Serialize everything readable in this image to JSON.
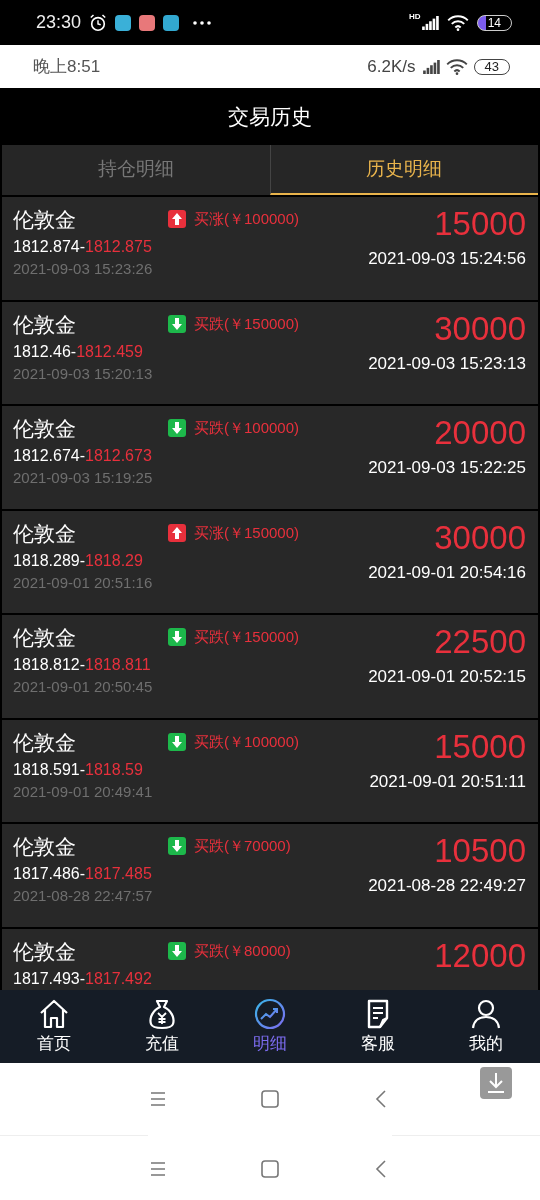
{
  "status_bar": {
    "time": "23:30",
    "hd": "HD",
    "battery": "14"
  },
  "inner_status_bar": {
    "time": "晚上8:51",
    "speed": "6.2K/s",
    "battery": "43"
  },
  "header": {
    "title": "交易历史"
  },
  "tabs": [
    {
      "label": "持仓明细",
      "selected": false
    },
    {
      "label": "历史明细",
      "selected": true
    }
  ],
  "trades": [
    {
      "name": "伦敦金",
      "kind": "up",
      "order": "买涨(￥100000)",
      "price_open": "1812.874-",
      "price_close": "1812.875",
      "open_time": "2021-09-03 15:23:26",
      "amount": "15000",
      "close_time": "2021-09-03 15:24:56"
    },
    {
      "name": "伦敦金",
      "kind": "down",
      "order": "买跌(￥150000)",
      "price_open": "1812.46-",
      "price_close": "1812.459",
      "open_time": "2021-09-03 15:20:13",
      "amount": "30000",
      "close_time": "2021-09-03 15:23:13"
    },
    {
      "name": "伦敦金",
      "kind": "down",
      "order": "买跌(￥100000)",
      "price_open": "1812.674-",
      "price_close": "1812.673",
      "open_time": "2021-09-03 15:19:25",
      "amount": "20000",
      "close_time": "2021-09-03 15:22:25"
    },
    {
      "name": "伦敦金",
      "kind": "up",
      "order": "买涨(￥150000)",
      "price_open": "1818.289-",
      "price_close": "1818.29",
      "open_time": "2021-09-01 20:51:16",
      "amount": "30000",
      "close_time": "2021-09-01 20:54:16"
    },
    {
      "name": "伦敦金",
      "kind": "down",
      "order": "买跌(￥150000)",
      "price_open": "1818.812-",
      "price_close": "1818.811",
      "open_time": "2021-09-01 20:50:45",
      "amount": "22500",
      "close_time": "2021-09-01 20:52:15"
    },
    {
      "name": "伦敦金",
      "kind": "down",
      "order": "买跌(￥100000)",
      "price_open": "1818.591-",
      "price_close": "1818.59",
      "open_time": "2021-09-01 20:49:41",
      "amount": "15000",
      "close_time": "2021-09-01 20:51:11"
    },
    {
      "name": "伦敦金",
      "kind": "down",
      "order": "买跌(￥70000)",
      "price_open": "1817.486-",
      "price_close": "1817.485",
      "open_time": "2021-08-28 22:47:57",
      "amount": "10500",
      "close_time": "2021-08-28 22:49:27"
    },
    {
      "name": "伦敦金",
      "kind": "down",
      "order": "买跌(￥80000)",
      "price_open": "1817.493-",
      "price_close": "1817.492",
      "amount": "12000"
    }
  ],
  "bottom_nav": [
    {
      "kind": "home",
      "label": "首页",
      "selected": false
    },
    {
      "kind": "money",
      "label": "充值",
      "selected": false
    },
    {
      "kind": "chart",
      "label": "明细",
      "selected": true
    },
    {
      "kind": "document",
      "label": "客服",
      "selected": false
    },
    {
      "kind": "user",
      "label": "我的",
      "selected": false
    }
  ]
}
